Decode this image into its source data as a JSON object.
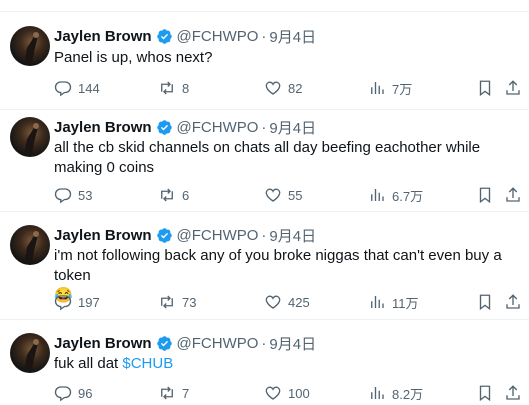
{
  "tweets": [
    {
      "name": "Jaylen Brown",
      "handle": "@FCHWPO",
      "dot": "·",
      "date": "9月4日",
      "text": "Panel is up, whos next?",
      "replies": "144",
      "retweets": "8",
      "likes": "82",
      "views": "7万"
    },
    {
      "name": "Jaylen Brown",
      "handle": "@FCHWPO",
      "dot": "·",
      "date": "9月4日",
      "text": "all the cb skid channels on chats all day beefing eachother while making 0 coins",
      "replies": "53",
      "retweets": "6",
      "likes": "55",
      "views": "6.7万"
    },
    {
      "name": "Jaylen Brown",
      "handle": "@FCHWPO",
      "dot": "·",
      "date": "9月4日",
      "text": "i'm not following back any of you broke niggas that can't even buy a token",
      "emoji": "😂",
      "replies": "197",
      "retweets": "73",
      "likes": "425",
      "views": "11万"
    },
    {
      "name": "Jaylen Brown",
      "handle": "@FCHWPO",
      "dot": "·",
      "date": "9月4日",
      "text": "fuk all dat ",
      "cashtag": "$CHUB",
      "replies": "96",
      "retweets": "7",
      "likes": "100",
      "views": "8.2万"
    }
  ],
  "colors": {
    "text": "#0f1419",
    "secondary": "#536471",
    "verified": "#1d9bf0",
    "divider": "#eff3f4"
  }
}
